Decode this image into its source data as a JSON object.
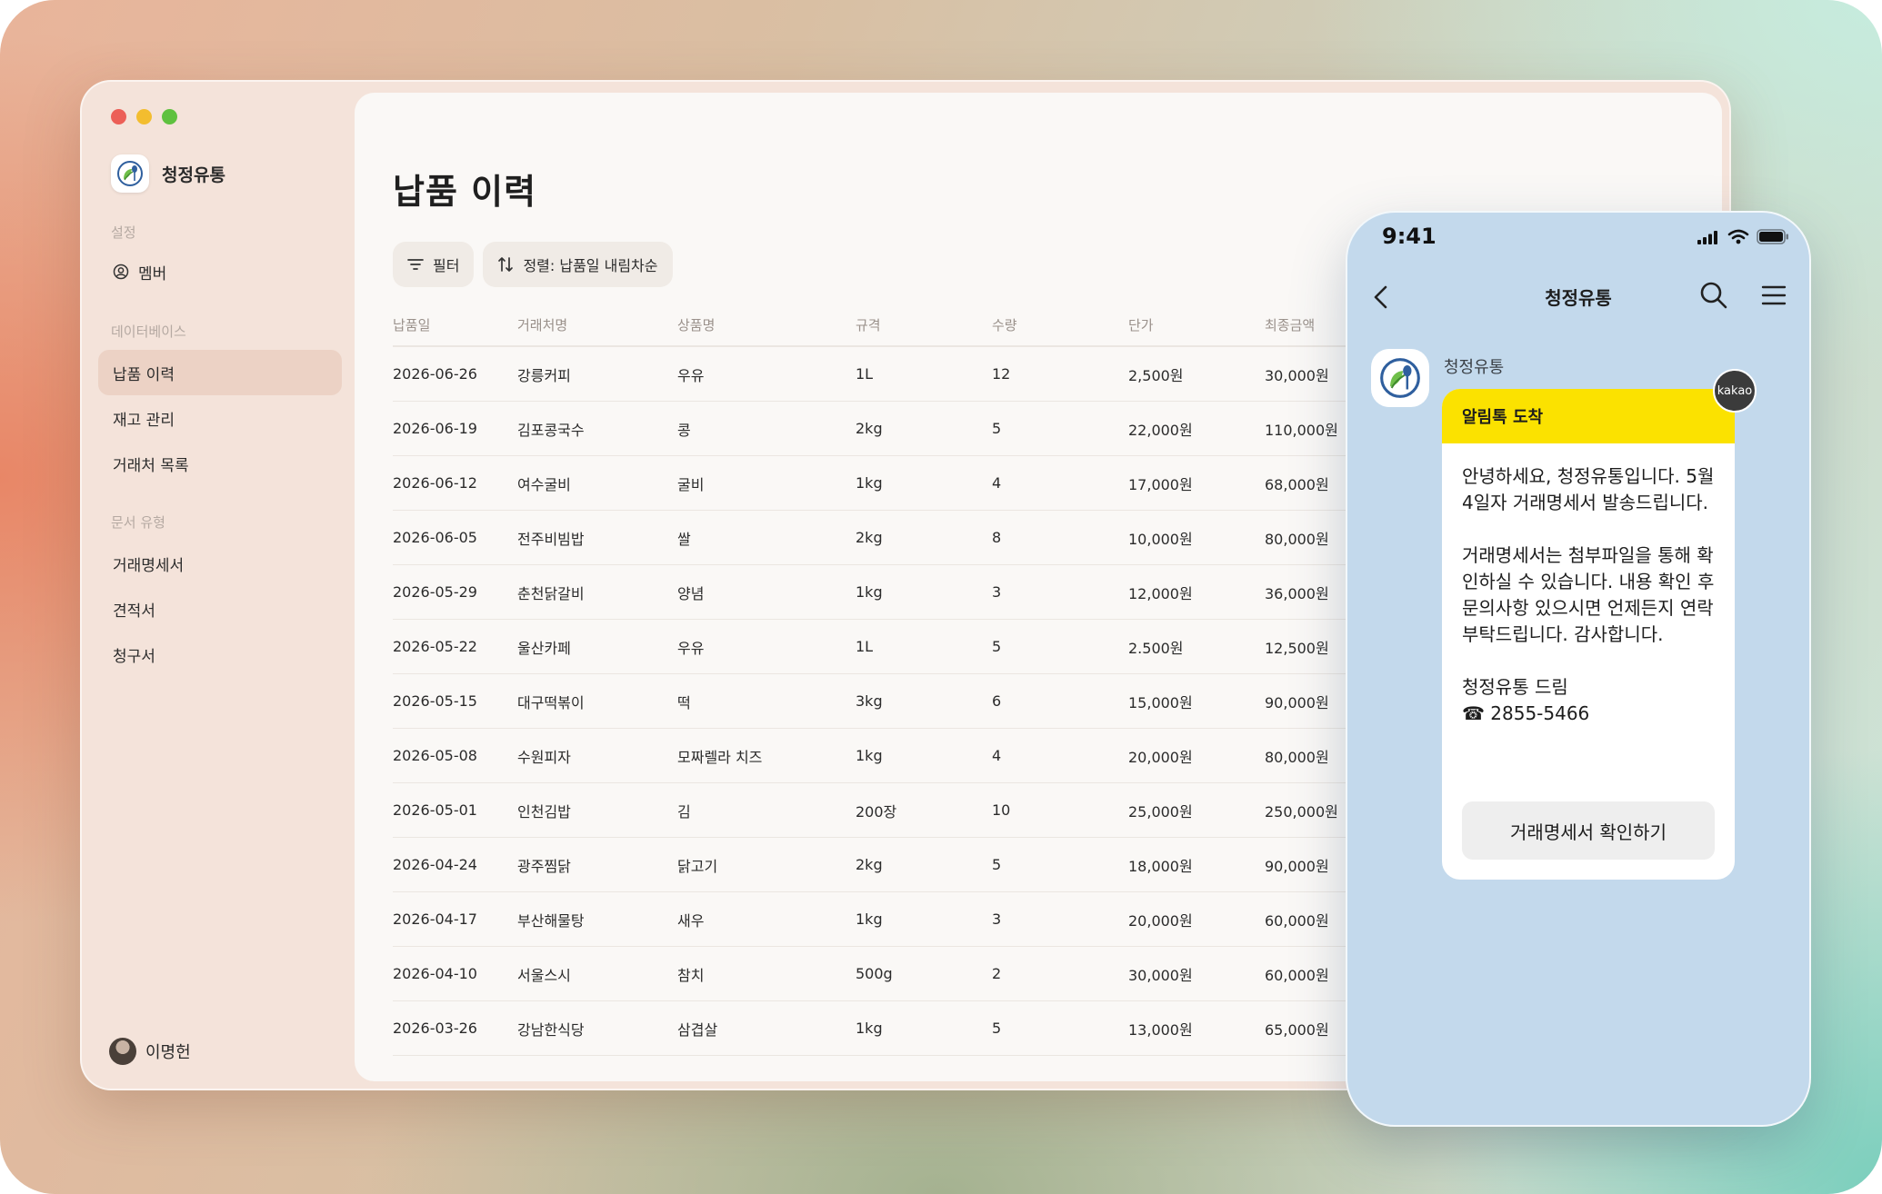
{
  "window": {
    "brand": "청정유통",
    "sections": {
      "settings": "설정",
      "database": "데이터베이스",
      "doc_types": "문서 유형"
    },
    "nav": {
      "members": "멤버",
      "delivery_history": "납품 이력",
      "inventory": "재고 관리",
      "clients": "거래처 목록",
      "statement": "거래명세서",
      "quote": "견적서",
      "invoice": "청구서"
    },
    "user_name": "이명헌"
  },
  "main": {
    "title": "납품 이력",
    "filter_label": "필터",
    "sort_label": "정렬: 납품일 내림차순",
    "columns": [
      "납품일",
      "거래처명",
      "상품명",
      "규격",
      "수량",
      "단가",
      "최종금액"
    ],
    "rows": [
      [
        "2026-06-26",
        "강릉커피",
        "우유",
        "1L",
        "12",
        "2,500원",
        "30,000원"
      ],
      [
        "2026-06-19",
        "김포콩국수",
        "콩",
        "2kg",
        "5",
        "22,000원",
        "110,000원"
      ],
      [
        "2026-06-12",
        "여수굴비",
        "굴비",
        "1kg",
        "4",
        "17,000원",
        "68,000원"
      ],
      [
        "2026-06-05",
        "전주비빔밥",
        "쌀",
        "2kg",
        "8",
        "10,000원",
        "80,000원"
      ],
      [
        "2026-05-29",
        "춘천닭갈비",
        "양념",
        "1kg",
        "3",
        "12,000원",
        "36,000원"
      ],
      [
        "2026-05-22",
        "울산카페",
        "우유",
        "1L",
        "5",
        "2.500원",
        "12,500원"
      ],
      [
        "2026-05-15",
        "대구떡볶이",
        "떡",
        "3kg",
        "6",
        "15,000원",
        "90,000원"
      ],
      [
        "2026-05-08",
        "수원피자",
        "모짜렐라 치즈",
        "1kg",
        "4",
        "20,000원",
        "80,000원"
      ],
      [
        "2026-05-01",
        "인천김밥",
        "김",
        "200장",
        "10",
        "25,000원",
        "250,000원"
      ],
      [
        "2026-04-24",
        "광주찜닭",
        "닭고기",
        "2kg",
        "5",
        "18,000원",
        "90,000원"
      ],
      [
        "2026-04-17",
        "부산해물탕",
        "새우",
        "1kg",
        "3",
        "20,000원",
        "60,000원"
      ],
      [
        "2026-04-10",
        "서울스시",
        "참치",
        "500g",
        "2",
        "30,000원",
        "60,000원"
      ],
      [
        "2026-03-26",
        "강남한식당",
        "삼겹살",
        "1kg",
        "5",
        "13,000원",
        "65,000원"
      ]
    ]
  },
  "phone": {
    "time": "9:41",
    "chat_title": "청정유통",
    "sender": "청정유통",
    "badge": "kakao",
    "alert_title": "알림톡 도착",
    "message": {
      "p1": "안녕하세요, 청정유통입니다. 5월 4일자 거래명세서 발송드립니다.",
      "p2": "거래명세서는 첨부파일을 통해 확인하실 수 있습니다. 내용 확인 후 문의사항 있으시면 언제든지 연락 부탁드립니다. 감사합니다.",
      "signature": "청정유통 드림",
      "phone_number": "☎ 2855-5466"
    },
    "button_label": "거래명세서 확인하기"
  },
  "colors": {
    "accent_yellow": "#fbe200",
    "active_nav": "#ecd2c5",
    "phone_bg": "#c3d9ec"
  },
  "icons": [
    "filter-icon",
    "sort-icon",
    "member-icon",
    "back-icon",
    "search-icon",
    "menu-icon",
    "signal-icon",
    "wifi-icon",
    "battery-icon",
    "logo-icon"
  ]
}
